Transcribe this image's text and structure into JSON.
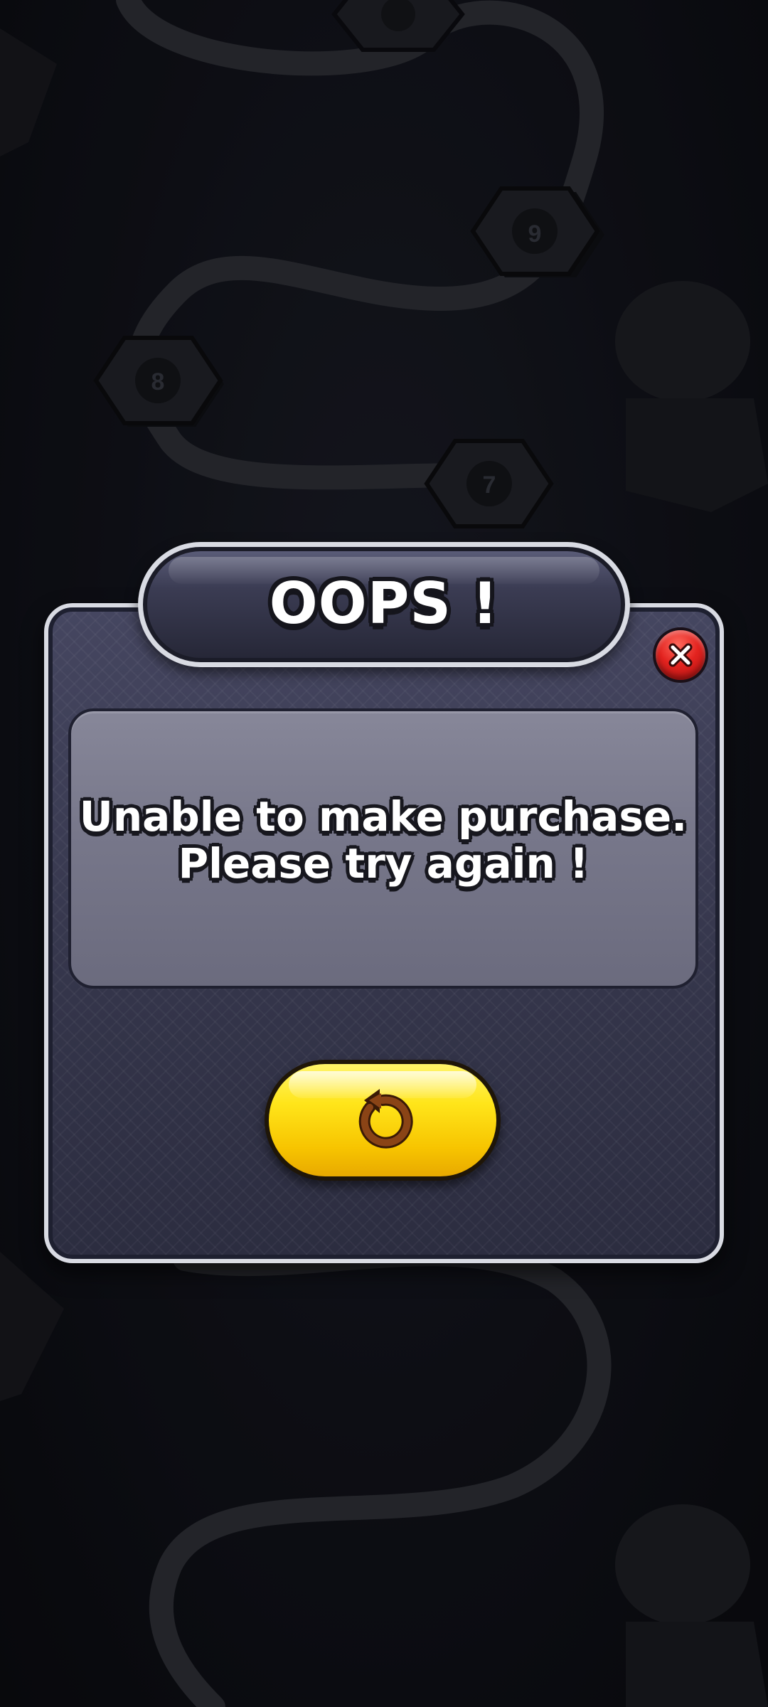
{
  "background": {
    "theme": "dark level map",
    "visible_level_numbers": [
      "9",
      "8",
      "7"
    ]
  },
  "dialog": {
    "title": "OOPS !",
    "message_lines": [
      "Unable to make purchase.",
      "Please try again !"
    ],
    "close_icon": "close-x-icon",
    "retry_icon": "retry-arrow-icon"
  },
  "colors": {
    "background": "#101118",
    "panel": "#3a3b52",
    "message_panel": "#7a7a8d",
    "close_button": "#e3231f",
    "retry_button": "#ffe51a",
    "retry_icon": "#7a3c12"
  }
}
